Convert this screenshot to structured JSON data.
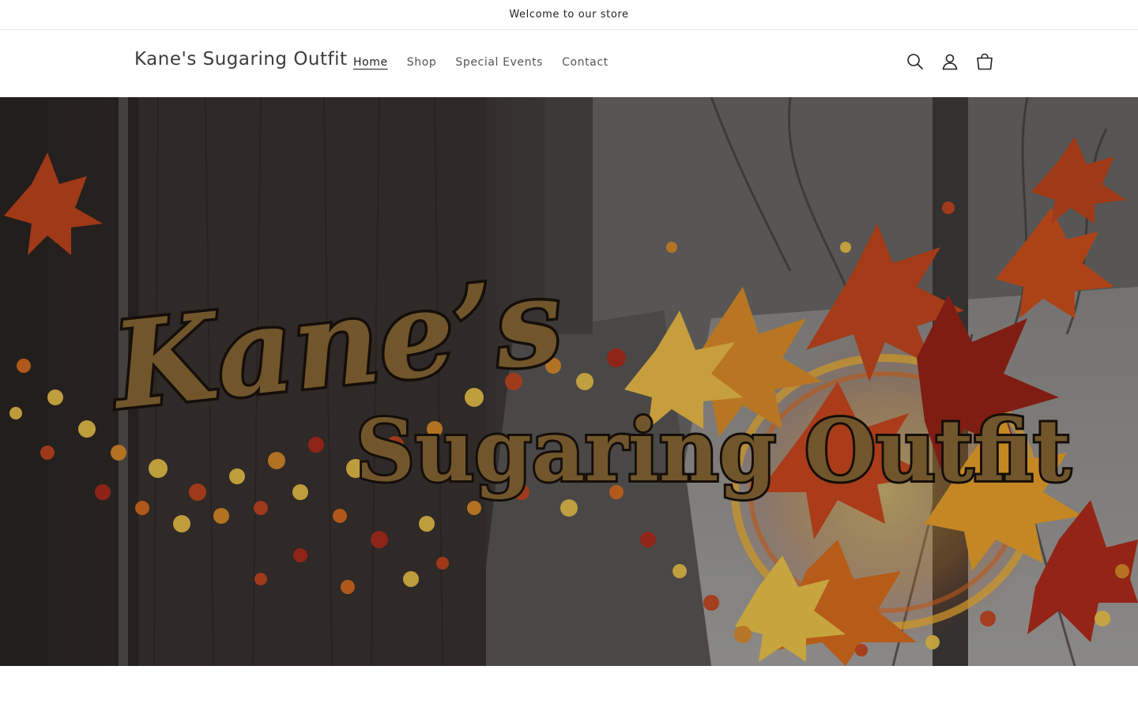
{
  "announcement": {
    "text": "Welcome to our store"
  },
  "header": {
    "brand": "Kane's Sugaring Outfit",
    "nav": [
      {
        "label": "Home",
        "active": true
      },
      {
        "label": "Shop",
        "active": false
      },
      {
        "label": "Special Events",
        "active": false
      },
      {
        "label": "Contact",
        "active": false
      }
    ],
    "icons": [
      "search-icon",
      "account-icon",
      "cart-icon"
    ]
  },
  "hero": {
    "logo_line1": "Kane’s",
    "logo_line2": "Sugaring Outfit",
    "colors": {
      "logo_fill": "#8a6a35",
      "logo_outline": "#1a120c",
      "leaf_red": "#b5301e",
      "leaf_orange": "#e07a22",
      "leaf_yellow": "#f2c94c"
    }
  }
}
